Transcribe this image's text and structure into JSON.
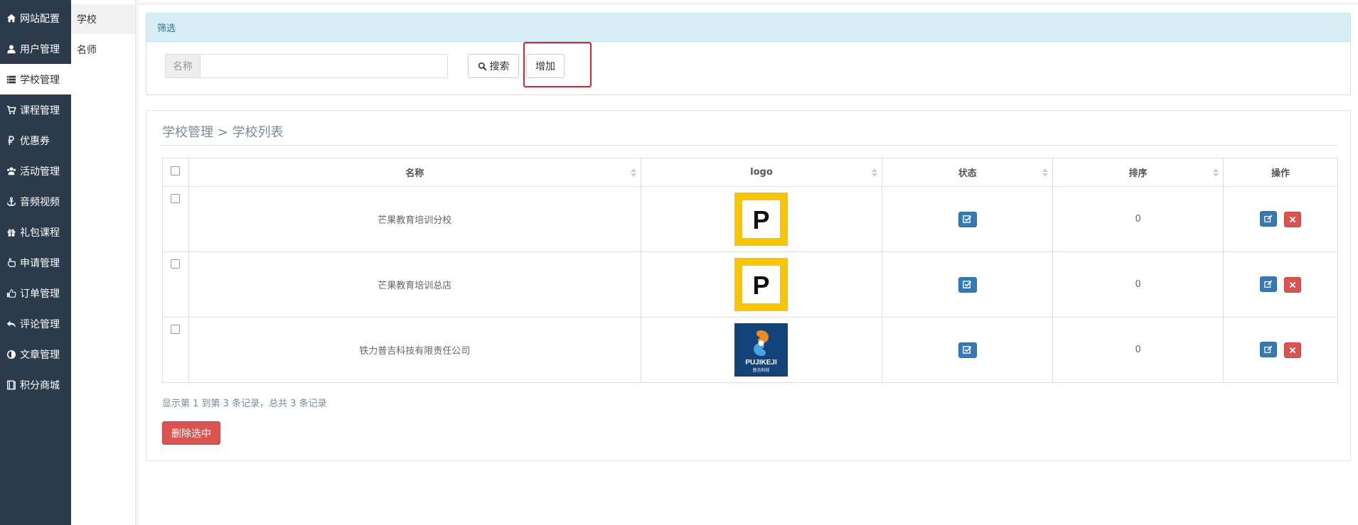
{
  "sidebar": {
    "items": [
      {
        "label": "网站配置",
        "icon": "home-icon"
      },
      {
        "label": "用户管理",
        "icon": "user-icon"
      },
      {
        "label": "学校管理",
        "icon": "server-icon",
        "active": true
      },
      {
        "label": "课程管理",
        "icon": "cart-icon"
      },
      {
        "label": "优惠券",
        "icon": "ruble-icon"
      },
      {
        "label": "活动管理",
        "icon": "users-icon"
      },
      {
        "label": "音频视频",
        "icon": "anchor-icon"
      },
      {
        "label": "礼包课程",
        "icon": "gift-icon"
      },
      {
        "label": "申请管理",
        "icon": "hand-pointer-icon"
      },
      {
        "label": "订单管理",
        "icon": "thumbs-up-icon"
      },
      {
        "label": "评论管理",
        "icon": "reply-icon"
      },
      {
        "label": "文章管理",
        "icon": "adjust-icon"
      },
      {
        "label": "积分商城",
        "icon": "book-icon"
      }
    ]
  },
  "subnav": {
    "items": [
      {
        "label": "学校",
        "active": true
      },
      {
        "label": "名师"
      }
    ]
  },
  "filter": {
    "title": "筛选",
    "name_label": "名称",
    "name_value": "",
    "search_label": "搜索",
    "add_label": "增加"
  },
  "list": {
    "breadcrumb": "学校管理 > 学校列表",
    "columns": [
      "名称",
      "logo",
      "状态",
      "排序",
      "操作"
    ],
    "rows": [
      {
        "name": "芒果教育培训分校",
        "logo": "p-logo",
        "status_checked": true,
        "sort": "0"
      },
      {
        "name": "芒果教育培训总店",
        "logo": "p-logo",
        "status_checked": true,
        "sort": "0"
      },
      {
        "name": "铁力普吉科技有限责任公司",
        "logo": "pujikeji-logo",
        "status_checked": true,
        "sort": "0"
      }
    ],
    "pagination_info": "显示第 1 到第 3 条记录，总共 3 条记录",
    "delete_selected_label": "删除选中"
  },
  "colors": {
    "sidebar_bg": "#2c3b4c",
    "primary": "#337ab7",
    "danger": "#d9534f",
    "info_header": "#d9edf7",
    "highlight_box": "#e0202a",
    "logo_yellow": "#f7c600",
    "logo_blue": "#12437a"
  },
  "logos": {
    "p_letter": "P",
    "pujikeji_text": "PUJIKEJI",
    "pujikeji_cn": "普吉科技"
  }
}
